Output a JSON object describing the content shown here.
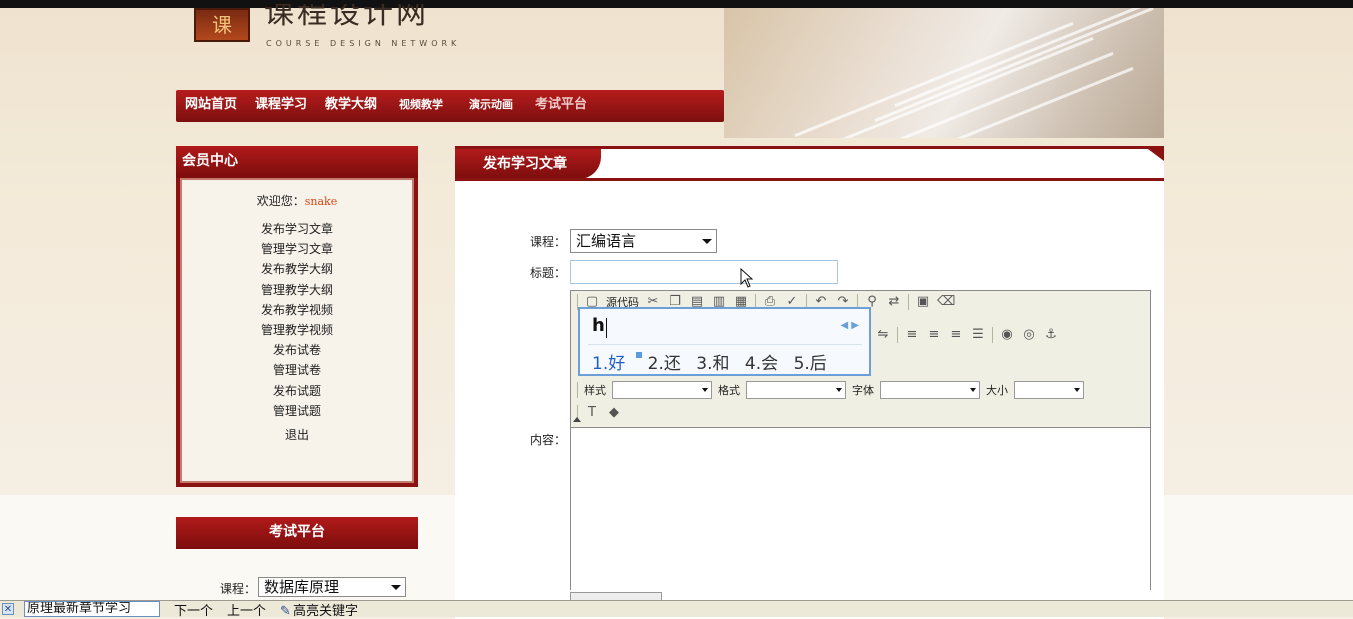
{
  "header": {
    "logo_char": "课",
    "site_title": "课程设计网",
    "site_subtitle": "COURSE DESIGN NETWORK"
  },
  "nav": {
    "items": [
      "网站首页",
      "课程学习",
      "教学大纲",
      "视频教学",
      "演示动画",
      "考试平台"
    ]
  },
  "sidebar": {
    "title": "会员中心",
    "welcome_label": "欢迎您：",
    "username": "snake",
    "links": [
      "发布学习文章",
      "管理学习文章",
      "发布教学大纲",
      "管理教学大纲",
      "发布教学视频",
      "管理教学视频",
      "发布试卷",
      "管理试卷",
      "发布试题",
      "管理试题"
    ],
    "logout": "退出"
  },
  "exam": {
    "title": "考试平台",
    "course_label": "课程：",
    "course_value": "数据库原理"
  },
  "main": {
    "tab_title": "发布学习文章",
    "course_label": "课程：",
    "course_value": "汇编语言",
    "title_label": "标题：",
    "title_value": "",
    "content_label": "内容："
  },
  "editor": {
    "source_label": "源代码",
    "style_label": "样式",
    "format_label": "格式",
    "font_label": "字体",
    "size_label": "大小"
  },
  "ime": {
    "input": "h",
    "candidates": [
      "1.好",
      "2.还",
      "3.和",
      "4.会",
      "5.后"
    ]
  },
  "findbar": {
    "search_value": "原理最新章节学习",
    "next_label": "下一个",
    "prev_label": "上一个",
    "highlight_label": "高亮关键字"
  }
}
